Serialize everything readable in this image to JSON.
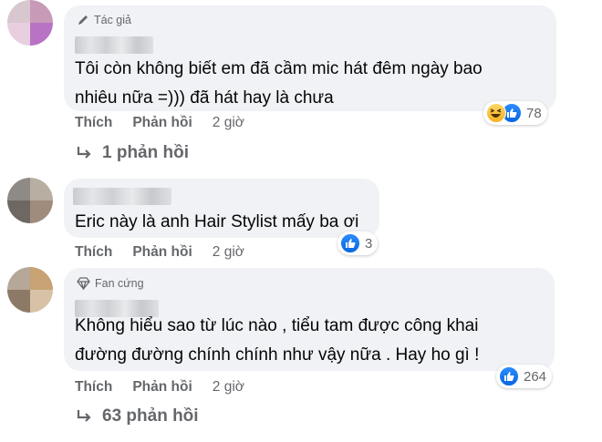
{
  "comments": [
    {
      "badge": "Tác giả",
      "text_lines": [
        "Tôi còn không biết em đã cầm mic hát đêm ngày bao",
        "nhiêu nữa =))) đã hát hay là chưa"
      ],
      "actions": {
        "like": "Thích",
        "reply": "Phản hồi",
        "time": "2 giờ"
      },
      "reactions": [
        "haha-icon",
        "like-icon"
      ],
      "reaction_count": "78",
      "replies_label": "1 phản hồi"
    },
    {
      "badge": "",
      "text_lines": [
        "Eric này là anh Hair Stylist mấy ba ơi"
      ],
      "actions": {
        "like": "Thích",
        "reply": "Phản hồi",
        "time": "2 giờ"
      },
      "reactions": [
        "like-icon"
      ],
      "reaction_count": "3",
      "replies_label": ""
    },
    {
      "badge": "Fan cứng",
      "text_lines": [
        "Không hiểu sao từ lúc nào , tiểu tam được công khai",
        "đường đường chính chính như vậy nữa . Hay ho gì !"
      ],
      "actions": {
        "like": "Thích",
        "reply": "Phản hồi",
        "time": "2 giờ"
      },
      "reactions": [
        "like-icon"
      ],
      "reaction_count": "264",
      "replies_label": "63 phản hồi"
    }
  ],
  "colors": {
    "bubble": "#f0f2f5",
    "action_text": "#65676b",
    "like_blue": "#1877f2"
  }
}
